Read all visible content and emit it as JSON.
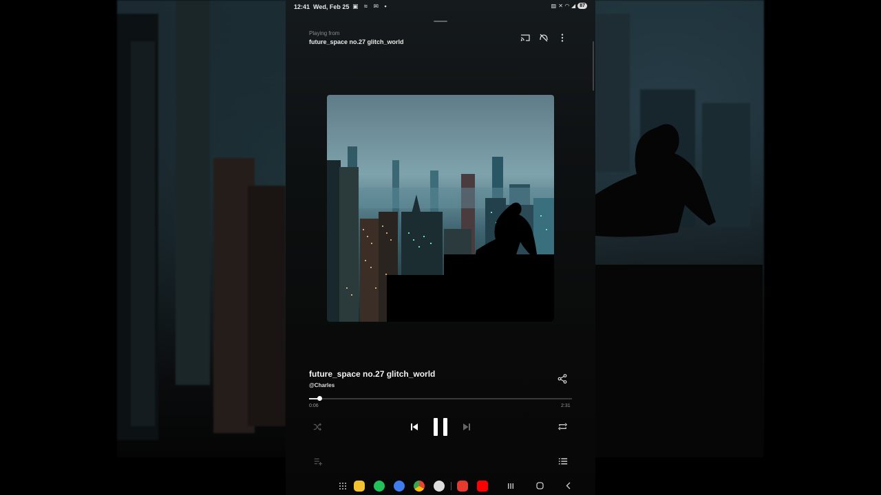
{
  "status_bar": {
    "time": "12:41",
    "date": "Wed, Feb 25",
    "battery": "87"
  },
  "header": {
    "playing_from_label": "Playing from",
    "playlist_name": "future_space no.27 glitch_world"
  },
  "track": {
    "title": "future_space no.27 glitch_world",
    "artist": "@Charles"
  },
  "progress": {
    "elapsed": "0:06",
    "total": "2:31",
    "fraction": 0.04
  },
  "colors": {
    "background": "#0a0a0a",
    "text_primary": "#f2f2f2",
    "text_secondary": "#8c8c8c",
    "progress_fill": "#e8e8e8"
  },
  "icons": {
    "top_bar": [
      "cast-icon",
      "no-signal-icon",
      "more-vert-icon"
    ],
    "controls": [
      "shuffle-icon",
      "skip-previous-icon",
      "pause-icon",
      "skip-next-icon",
      "repeat-icon"
    ],
    "bottom": [
      "add-to-queue-icon",
      "queue-list-icon"
    ],
    "dock": [
      "apps-grid-icon",
      "folder-app-icon",
      "phone-app-icon",
      "messages-app-icon",
      "chrome-app-icon",
      "camera-app-icon",
      "app-red-icon",
      "youtube-app-icon"
    ],
    "system_nav": [
      "recents-icon",
      "home-icon",
      "back-icon"
    ]
  }
}
